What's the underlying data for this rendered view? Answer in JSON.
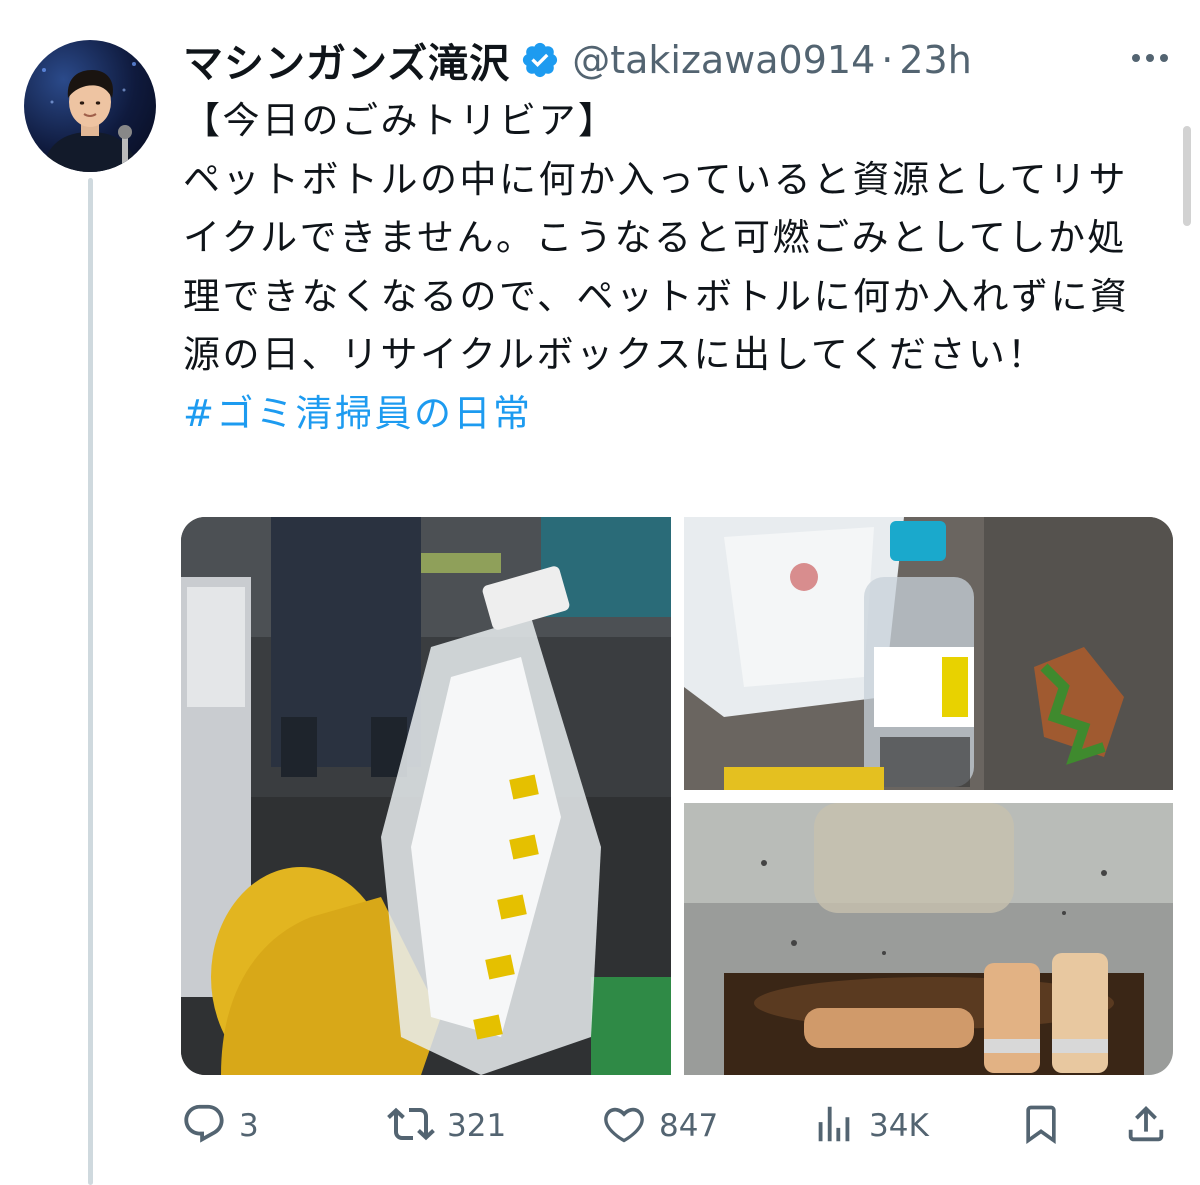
{
  "author": {
    "display_name": "マシンガンズ滝沢",
    "handle": "@takizawa0914",
    "separator": "·",
    "time": "23h",
    "verified": true
  },
  "tweet": {
    "line1": "【今日のごみトリビア】",
    "body": "ペットボトルの中に何か入っていると資源としてリサイクルできません。こうなると可燃ごみとしてしか処理できなくなるので、ペットボトルに何か入れずに資源の日、リサイクルボックスに出してください！",
    "hashtag": "#ゴミ清掃員の日常"
  },
  "media": {
    "count": 3,
    "images": [
      {
        "subject": "gloved hand holding plastic bottle stuffed with waste"
      },
      {
        "subject": "plastic bottle filled with cigarette butts on ground"
      },
      {
        "subject": "close-up of bottle with liquid and cigarette butts"
      }
    ]
  },
  "actions": {
    "replies": "3",
    "reposts": "321",
    "likes": "847",
    "views": "34K"
  },
  "colors": {
    "accent": "#1d9bf0",
    "text": "#0f1419",
    "muted": "#536471",
    "thread_line": "#cfd9de"
  },
  "icons": [
    "verified-badge-icon",
    "more-icon",
    "reply-icon",
    "repost-icon",
    "like-icon",
    "views-icon",
    "bookmark-icon",
    "share-icon"
  ]
}
